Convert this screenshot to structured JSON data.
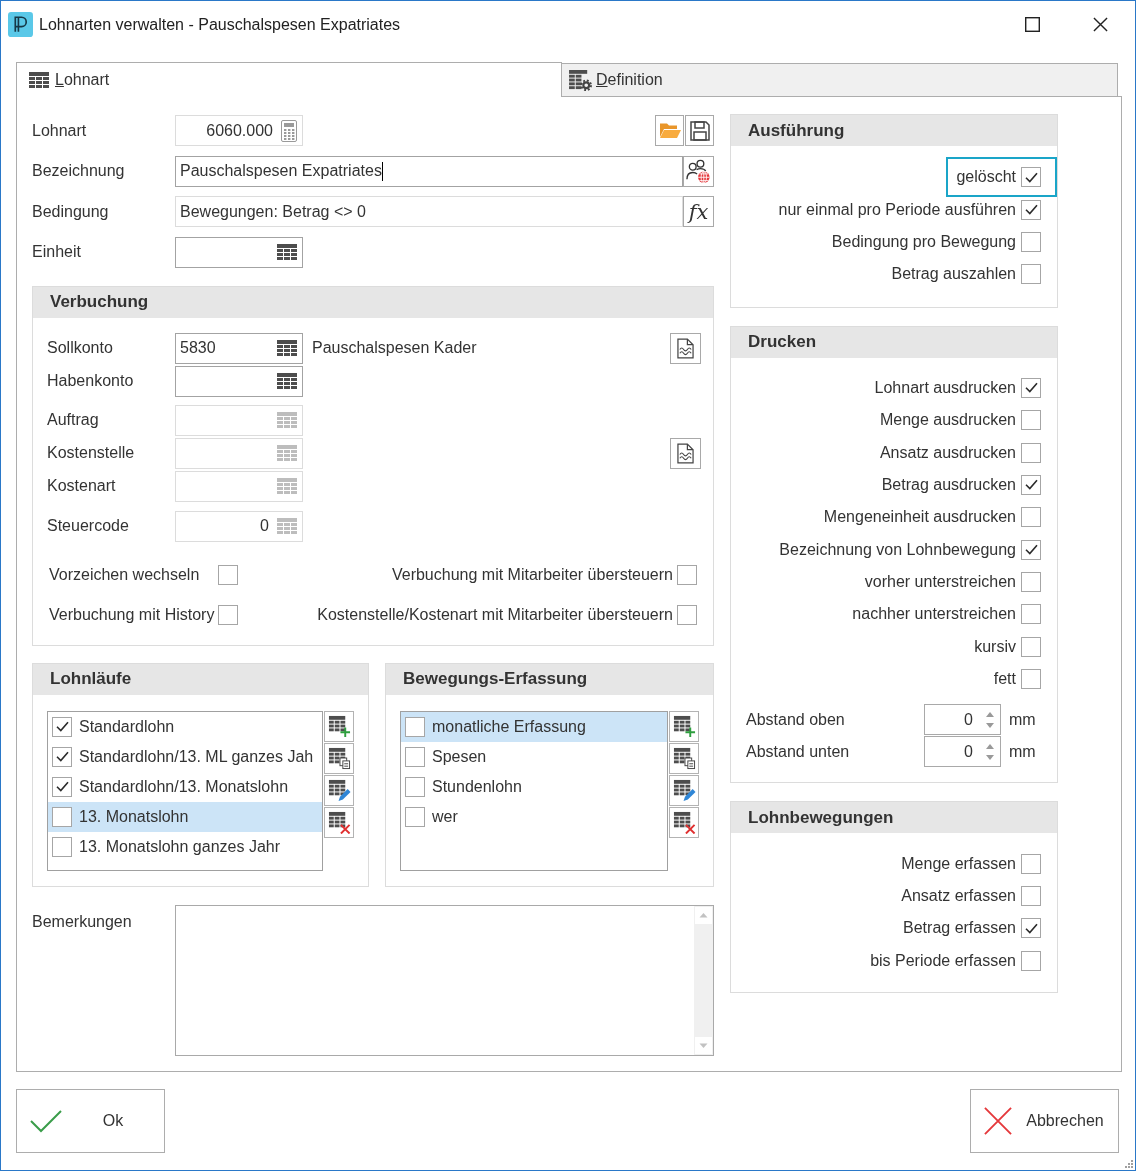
{
  "window": {
    "title": "Lohnarten verwalten - Pauschalspesen Expatriates"
  },
  "tabs": [
    {
      "label": "Lohnart",
      "selected": true
    },
    {
      "label": "Definition",
      "selected": false
    }
  ],
  "general": {
    "fields": [
      {
        "kind": "key",
        "label": "Lohnart",
        "value": "6060.000",
        "readonly": true,
        "focused": false
      },
      {
        "kind": "text",
        "label": "Bezeichnung",
        "value": "Pauschalspesen Expatriates",
        "readonly": false,
        "focused": true
      },
      {
        "kind": "formula",
        "label": "Bedingung",
        "value": "Bewegungen: Betrag <> 0",
        "button": "fx",
        "readonly": true,
        "focused": false
      },
      {
        "kind": "lookup",
        "label": "Einheit",
        "readonly": false,
        "focused": false
      }
    ]
  },
  "verbuchung": {
    "title": "Verbuchung",
    "groups": [
      {
        "fields": [
          {
            "kind": "account",
            "label": "Sollkonto",
            "value": "5830",
            "description": "Pauschalspesen Kader",
            "disabled": false,
            "detail_button": true
          },
          {
            "kind": "account",
            "label": "Habenkonto",
            "disabled": false,
            "detail_button": false
          }
        ]
      },
      {
        "fields": [
          {
            "kind": "account",
            "label": "Auftrag",
            "disabled": true,
            "detail_button": false
          },
          {
            "kind": "account",
            "label": "Kostenstelle",
            "disabled": true,
            "detail_button": true
          },
          {
            "kind": "account",
            "label": "Kostenart",
            "disabled": true,
            "detail_button": false
          }
        ]
      },
      {
        "fields": [
          {
            "kind": "number",
            "label": "Steuercode",
            "value": "0",
            "disabled": true,
            "detail_button": false
          }
        ]
      }
    ],
    "options": [
      {
        "label": "Vorzeichen wechseln",
        "checked": false
      },
      {
        "label": "Verbuchung mit Mitarbeiter übersteuern",
        "checked": false
      },
      {
        "label": "Verbuchung mit History",
        "checked": false
      },
      {
        "label": "Kostenstelle/Kostenart mit Mitarbeiter übersteuern",
        "checked": false
      }
    ]
  },
  "list_panels": [
    {
      "title": "Lohnläufe",
      "items": [
        {
          "label": "Standardlohn",
          "checked": true,
          "selected": false
        },
        {
          "label": "Standardlohn/13. ML ganzes Jah",
          "checked": true,
          "selected": false
        },
        {
          "label": "Standardlohn/13. Monatslohn",
          "checked": true,
          "selected": false
        },
        {
          "label": "13. Monatslohn",
          "checked": false,
          "selected": true
        },
        {
          "label": "13. Monatslohn ganzes Jahr",
          "checked": false,
          "selected": false
        }
      ]
    },
    {
      "title": "Bewegungs-Erfassung",
      "items": [
        {
          "label": "monatliche Erfassung",
          "checked": false,
          "selected": true
        },
        {
          "label": "Spesen",
          "checked": false,
          "selected": false
        },
        {
          "label": "Stundenlohn",
          "checked": false,
          "selected": false
        },
        {
          "label": "wer",
          "checked": false,
          "selected": false
        }
      ]
    }
  ],
  "bemerkungen": {
    "label": "Bemerkungen"
  },
  "option_sections": [
    {
      "title": "Ausführung",
      "options": [
        {
          "label": "gelöscht",
          "checked": true,
          "focused": true
        },
        {
          "label": "nur einmal pro Periode ausführen",
          "checked": true,
          "focused": false
        },
        {
          "label": "Bedingung pro Bewegung",
          "checked": false,
          "focused": false
        },
        {
          "label": "Betrag auszahlen",
          "checked": false,
          "focused": false
        }
      ]
    },
    {
      "title": "Drucken",
      "options": [
        {
          "label": "Lohnart ausdrucken",
          "checked": true
        },
        {
          "label": "Menge ausdrucken",
          "checked": false
        },
        {
          "label": "Ansatz ausdrucken",
          "checked": false
        },
        {
          "label": "Betrag ausdrucken",
          "checked": true
        },
        {
          "label": "Mengeneinheit ausdrucken",
          "checked": false
        },
        {
          "label": "Bezeichnung von Lohnbewegung",
          "checked": true
        },
        {
          "label": "vorher unterstreichen",
          "checked": false
        },
        {
          "label": "nachher unterstreichen",
          "checked": false
        },
        {
          "label": "kursiv",
          "checked": false
        },
        {
          "label": "fett",
          "checked": false
        }
      ],
      "spacing": [
        {
          "label": "Abstand oben",
          "value": "0",
          "unit": "mm"
        },
        {
          "label": "Abstand unten",
          "value": "0",
          "unit": "mm"
        }
      ]
    },
    {
      "title": "Lohnbewegungen",
      "options": [
        {
          "label": "Menge erfassen",
          "checked": false
        },
        {
          "label": "Ansatz erfassen",
          "checked": false
        },
        {
          "label": "Betrag erfassen",
          "checked": true
        },
        {
          "label": "bis Periode erfassen",
          "checked": false
        }
      ]
    }
  ],
  "buttons": [
    {
      "kind": "ok",
      "label": "Ok"
    },
    {
      "kind": "cancel",
      "label": "Abbrechen"
    }
  ]
}
